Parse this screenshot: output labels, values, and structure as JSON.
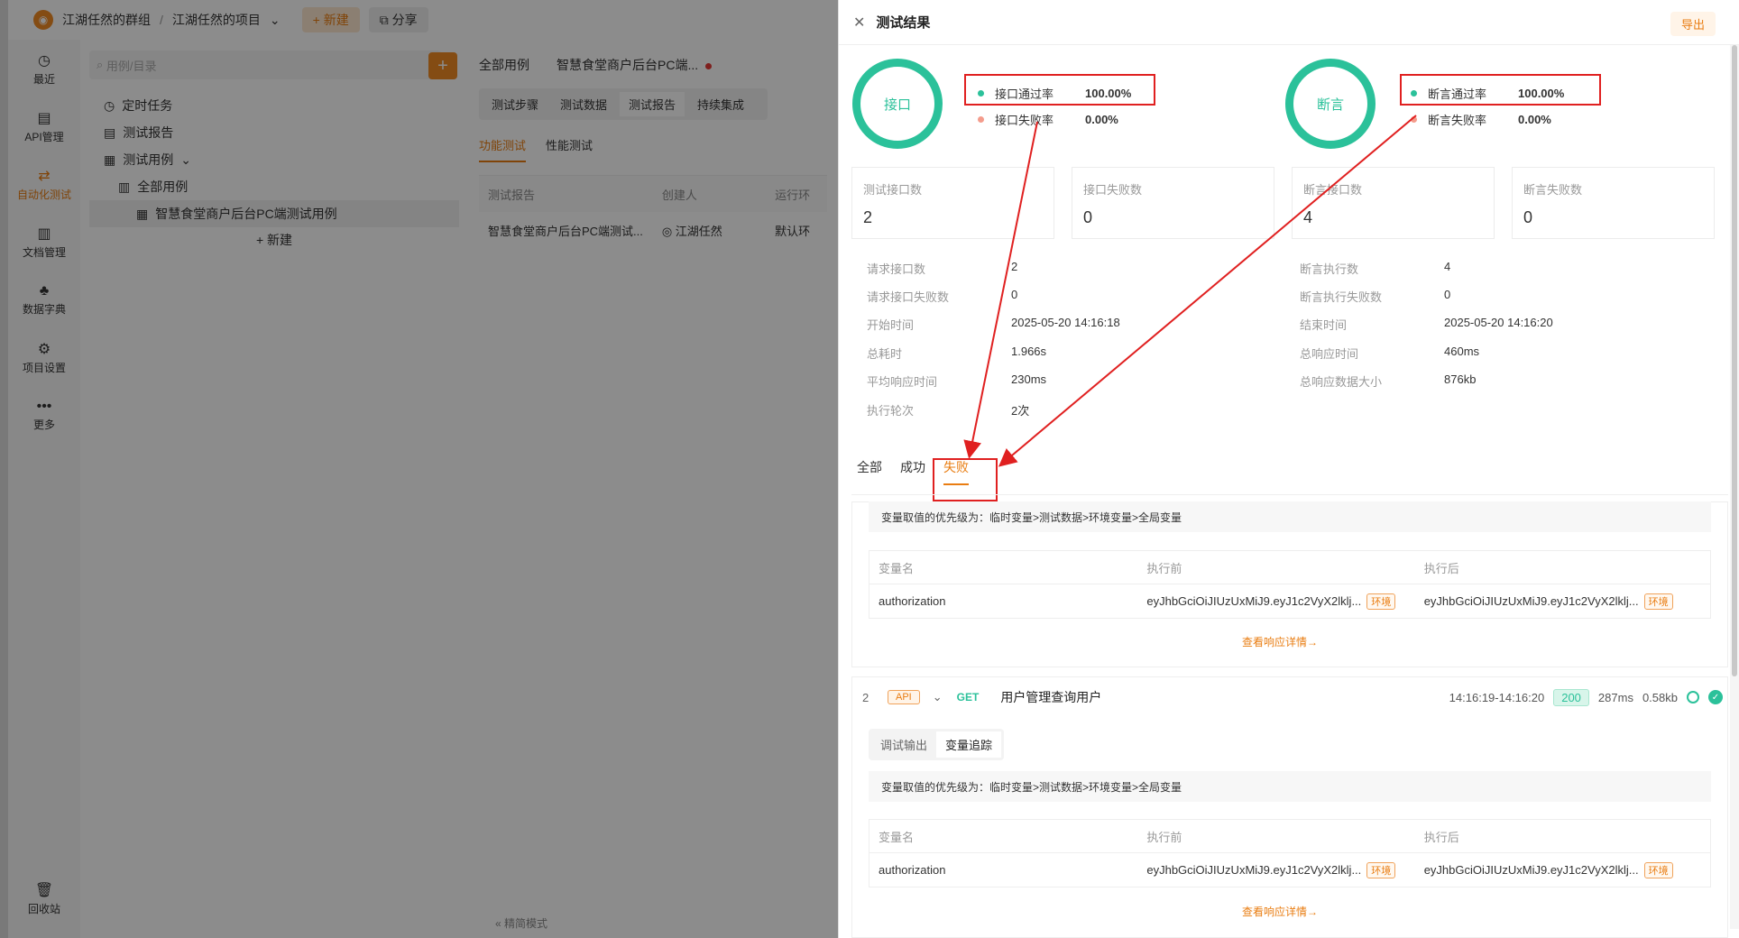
{
  "topbar": {
    "group": "江湖任然的群组",
    "sep": "/",
    "project": "江湖任然的项目",
    "new_btn": "+ 新建",
    "share_btn": "分享"
  },
  "nav": [
    {
      "label": "最近",
      "icon": "clock-icon",
      "glyph": "◷"
    },
    {
      "label": "API管理",
      "icon": "api-icon",
      "glyph": "▤"
    },
    {
      "label": "自动化测试",
      "icon": "automation-icon",
      "glyph": "⇄"
    },
    {
      "label": "文档管理",
      "icon": "doc-icon",
      "glyph": "▥"
    },
    {
      "label": "数据字典",
      "icon": "dict-icon",
      "glyph": "♣"
    },
    {
      "label": "项目设置",
      "icon": "settings-icon",
      "glyph": "⚙"
    },
    {
      "label": "更多",
      "icon": "more-icon",
      "glyph": "•••"
    }
  ],
  "nav_bottom": {
    "label": "回收站",
    "glyph": "🗑"
  },
  "tree": {
    "search_placeholder": "用例/目录",
    "items": [
      "定时任务",
      "测试报告",
      "测试用例"
    ],
    "all_cases": "全部用例",
    "case": "智慧食堂商户后台PC端测试用例",
    "new": "+ 新建"
  },
  "main": {
    "tab_all": "全部用例",
    "tab_case": "智慧食堂商户后台PC端...",
    "subtabs": [
      "测试步骤",
      "测试数据",
      "测试报告",
      "持续集成"
    ],
    "ftabs": [
      "功能测试",
      "性能测试"
    ],
    "table_headers": [
      "测试报告",
      "创建人",
      "运行环"
    ],
    "table_row": [
      "智慧食堂商户后台PC端测试...",
      "江湖任然",
      "默认环"
    ],
    "footer": "« 精简模式"
  },
  "drawer": {
    "title": "测试结果",
    "export": "导出",
    "ring1": "接口",
    "ring2": "断言",
    "api_pass_label": "接口通过率",
    "api_pass_value": "100.00%",
    "api_fail_label": "接口失败率",
    "api_fail_value": "0.00%",
    "assert_pass_label": "断言通过率",
    "assert_pass_value": "100.00%",
    "assert_fail_label": "断言失败率",
    "assert_fail_value": "0.00%",
    "cards": [
      {
        "label": "测试接口数",
        "value": "2"
      },
      {
        "label": "接口失败数",
        "value": "0"
      },
      {
        "label": "断言接口数",
        "value": "4"
      },
      {
        "label": "断言失败数",
        "value": "0"
      }
    ],
    "left_kv": [
      {
        "k": "请求接口数",
        "v": "2"
      },
      {
        "k": "请求接口失败数",
        "v": "0"
      },
      {
        "k": "开始时间",
        "v": "2025-05-20 14:16:18"
      },
      {
        "k": "总耗时",
        "v": "1.966s"
      },
      {
        "k": "平均响应时间",
        "v": "230ms"
      },
      {
        "k": "执行轮次",
        "v": "2次"
      }
    ],
    "right_kv": [
      {
        "k": "断言执行数",
        "v": "4"
      },
      {
        "k": "断言执行失败数",
        "v": "0"
      },
      {
        "k": "结束时间",
        "v": "2025-05-20 14:16:20"
      },
      {
        "k": "总响应时间",
        "v": "460ms"
      },
      {
        "k": "总响应数据大小",
        "v": "876kb"
      }
    ],
    "result_tabs": [
      "全部",
      "成功",
      "失败"
    ],
    "notice": "变量取值的优先级为：临时变量>测试数据>环境变量>全局变量",
    "var_headers": [
      "变量名",
      "执行前",
      "执行后"
    ],
    "var_row": {
      "name": "authorization",
      "before": "eyJhbGciOiJIUzUxMiJ9.eyJ1c2VyX2lklj...",
      "after": "eyJhbGciOiJIUzUxMiJ9.eyJ1c2VyX2lklj...",
      "tag": "环境"
    },
    "more_link": "查看响应详情→",
    "step": {
      "num": "2",
      "tag": "API",
      "method": "GET",
      "name": "用户管理查询用户",
      "time": "14:16:19-14:16:20",
      "code": "200",
      "duration": "287ms",
      "size": "0.58kb"
    },
    "seg_tabs": [
      "调试输出",
      "变量追踪"
    ]
  },
  "colors": {
    "accent": "#e97d12",
    "success": "#2bc19a",
    "annotation": "#e02020"
  }
}
